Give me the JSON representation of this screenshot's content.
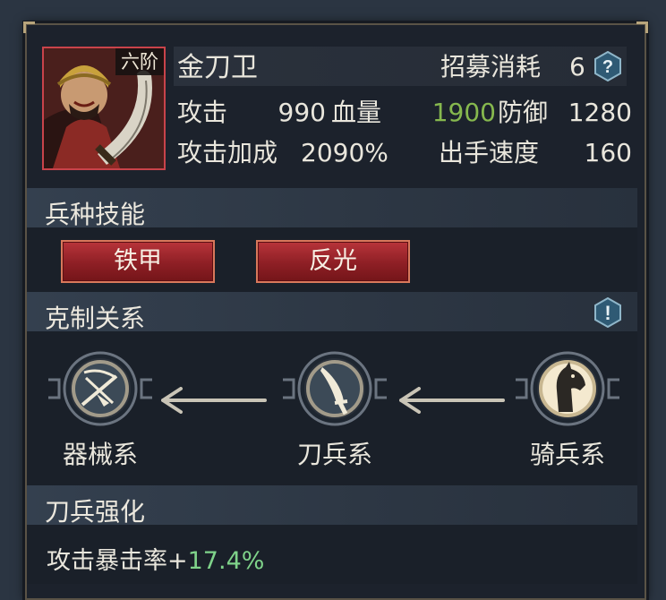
{
  "unit": {
    "rank": "六阶",
    "name": "金刀卫",
    "cost_label": "招募消耗",
    "cost_value": "6",
    "stats": {
      "attack_label": "攻击",
      "attack_value": "990",
      "hp_label": "血量",
      "hp_value": "1900",
      "defense_label": "防御",
      "defense_value": "1280",
      "attack_bonus_label": "攻击加成",
      "attack_bonus_value": "2090%",
      "speed_label": "出手速度",
      "speed_value": "160"
    }
  },
  "skills": {
    "title": "兵种技能",
    "items": [
      "铁甲",
      "反光"
    ]
  },
  "counter": {
    "title": "克制关系",
    "types": [
      "器械系",
      "刀兵系",
      "骑兵系"
    ]
  },
  "enhance": {
    "title": "刀兵强化",
    "text": "攻击暴击率+",
    "value": "17.4%"
  },
  "colors": {
    "accent_green": "#86b84e",
    "bonus_green": "#7fd38a",
    "skill_red": "#a52a30"
  },
  "icons": {
    "help": "question-icon",
    "info": "exclamation-icon",
    "siege": "crossbow-icon",
    "blade": "sword-icon",
    "cavalry": "horse-icon"
  }
}
